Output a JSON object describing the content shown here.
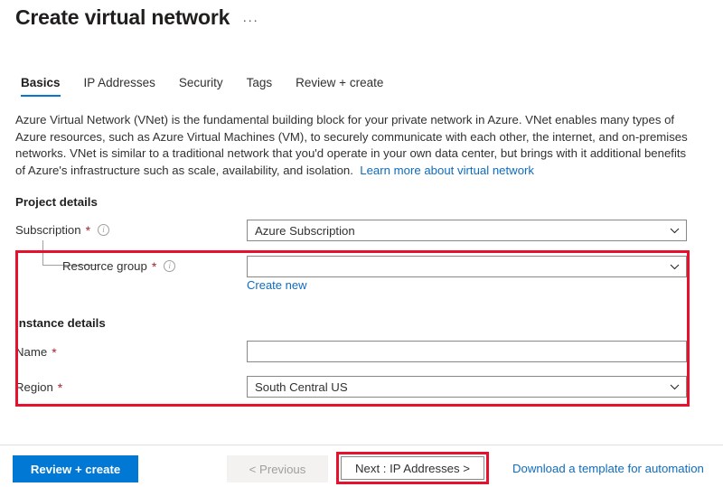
{
  "header": {
    "title": "Create virtual network",
    "more_actions": "···"
  },
  "tabs": [
    {
      "label": "Basics",
      "active": true
    },
    {
      "label": "IP Addresses",
      "active": false
    },
    {
      "label": "Security",
      "active": false
    },
    {
      "label": "Tags",
      "active": false
    },
    {
      "label": "Review + create",
      "active": false
    }
  ],
  "description": {
    "text": "Azure Virtual Network (VNet) is the fundamental building block for your private network in Azure. VNet enables many types of Azure resources, such as Azure Virtual Machines (VM), to securely communicate with each other, the internet, and on-premises networks. VNet is similar to a traditional network that you'd operate in your own data center, but brings with it additional benefits of Azure's infrastructure such as scale, availability, and isolation.",
    "link_label": "Learn more about virtual network"
  },
  "project_details": {
    "heading": "Project details",
    "subscription": {
      "label": "Subscription",
      "required_marker": "*",
      "info_icon": "info-icon",
      "value": "Azure Subscription",
      "chevron": "chevron-down-icon"
    },
    "resource_group": {
      "label": "Resource group",
      "required_marker": "*",
      "info_icon": "info-icon",
      "value": "",
      "chevron": "chevron-down-icon",
      "create_new_label": "Create new"
    }
  },
  "instance_details": {
    "heading": "Instance details",
    "name": {
      "label": "Name",
      "required_marker": "*",
      "value": ""
    },
    "region": {
      "label": "Region",
      "required_marker": "*",
      "value": "South Central US",
      "chevron": "chevron-down-icon"
    }
  },
  "footer": {
    "review_create_label": "Review + create",
    "previous_label": "< Previous",
    "next_label": "Next : IP Addresses >",
    "download_label": "Download a template for automation"
  },
  "annotations": {
    "color": "#e8112d",
    "boxes": [
      {
        "name": "highlight-resource-group-and-instance-details"
      },
      {
        "name": "highlight-next-button"
      }
    ]
  },
  "colors": {
    "accent": "#0078d4",
    "link": "#0f6cbd",
    "required": "#a4262c",
    "annotation": "#e8112d",
    "text": "#323130"
  }
}
